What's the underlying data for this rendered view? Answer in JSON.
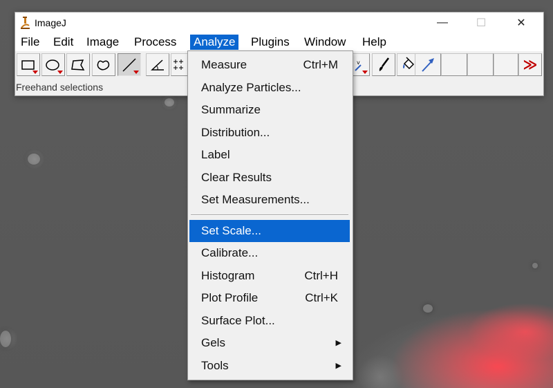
{
  "window": {
    "title": "ImageJ",
    "controls": {
      "minimize": "—",
      "maximize": "☐",
      "close": "✕"
    }
  },
  "menubar": {
    "items": [
      {
        "label": "File"
      },
      {
        "label": "Edit"
      },
      {
        "label": "Image"
      },
      {
        "label": "Process"
      },
      {
        "label": "Analyze",
        "active": true
      },
      {
        "label": "Plugins"
      },
      {
        "label": "Window"
      },
      {
        "label": "Help"
      }
    ]
  },
  "toolbar": {
    "tools": [
      {
        "name": "rectangle-tool-icon"
      },
      {
        "name": "oval-tool-icon"
      },
      {
        "name": "polygon-tool-icon"
      },
      {
        "name": "freehand-tool-icon"
      },
      {
        "name": "line-tool-icon",
        "selected": true
      },
      {
        "name": "angle-tool-icon"
      },
      {
        "name": "multipoint-tool-icon"
      },
      {
        "name": "dropper-tool-icon"
      },
      {
        "name": "brush-tool-icon"
      },
      {
        "name": "flood-fill-tool-icon"
      },
      {
        "name": "arrow-tool-icon"
      },
      {
        "name": "more-tools-icon",
        "glyph": "≫",
        "color": "#c00000"
      }
    ],
    "status": "Freehand selections"
  },
  "analyze_menu": {
    "items": [
      {
        "label": "Measure",
        "shortcut": "Ctrl+M"
      },
      {
        "label": "Analyze Particles..."
      },
      {
        "label": "Summarize"
      },
      {
        "label": "Distribution..."
      },
      {
        "label": "Label"
      },
      {
        "label": "Clear Results"
      },
      {
        "label": "Set Measurements..."
      },
      {
        "separator": true
      },
      {
        "label": "Set Scale...",
        "highlighted": true
      },
      {
        "label": "Calibrate..."
      },
      {
        "label": "Histogram",
        "shortcut": "Ctrl+H"
      },
      {
        "label": "Plot Profile",
        "shortcut": "Ctrl+K"
      },
      {
        "label": "Surface Plot..."
      },
      {
        "label": "Gels",
        "submenu": true,
        "arrow": "▶"
      },
      {
        "label": "Tools",
        "submenu": true,
        "arrow": "▶"
      }
    ]
  },
  "colors": {
    "highlight": "#0a66d0",
    "fluorescence": "#ff4650"
  }
}
